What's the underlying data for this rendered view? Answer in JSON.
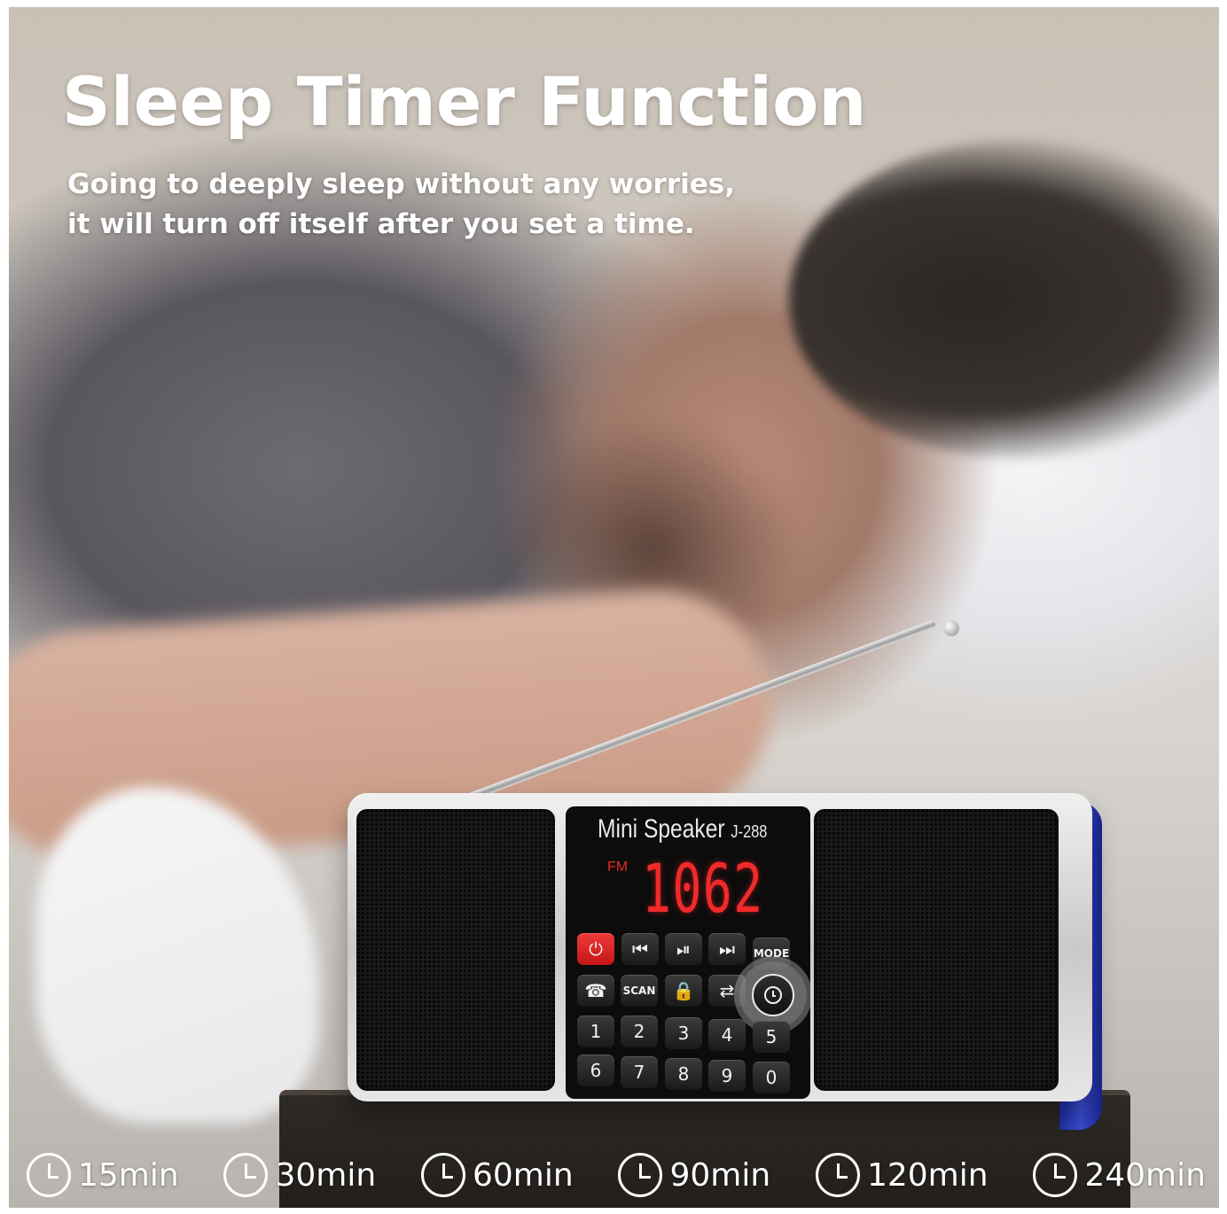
{
  "headline": "Sleep Timer Function",
  "subtext": {
    "line1": "Going to deeply sleep without any worries,",
    "line2": "it will turn off itself after you set a time."
  },
  "radio": {
    "brand": "Mini Speaker",
    "model": "J-288",
    "band": "FM",
    "display": "1062",
    "keys": {
      "scan": "SCAN",
      "mode": "MODE",
      "digits": [
        "1",
        "2",
        "3",
        "4",
        "5",
        "6",
        "7",
        "8",
        "9",
        "0"
      ]
    }
  },
  "durations": [
    "15min",
    "30min",
    "60min",
    "90min",
    "120min",
    "240min"
  ],
  "icons": {
    "duration": "clock-icon",
    "timer_key": "clock-icon"
  },
  "colors": {
    "display": "#f02a2a",
    "power_key": "#e02424",
    "radio_accent": "#2a3bc4"
  }
}
